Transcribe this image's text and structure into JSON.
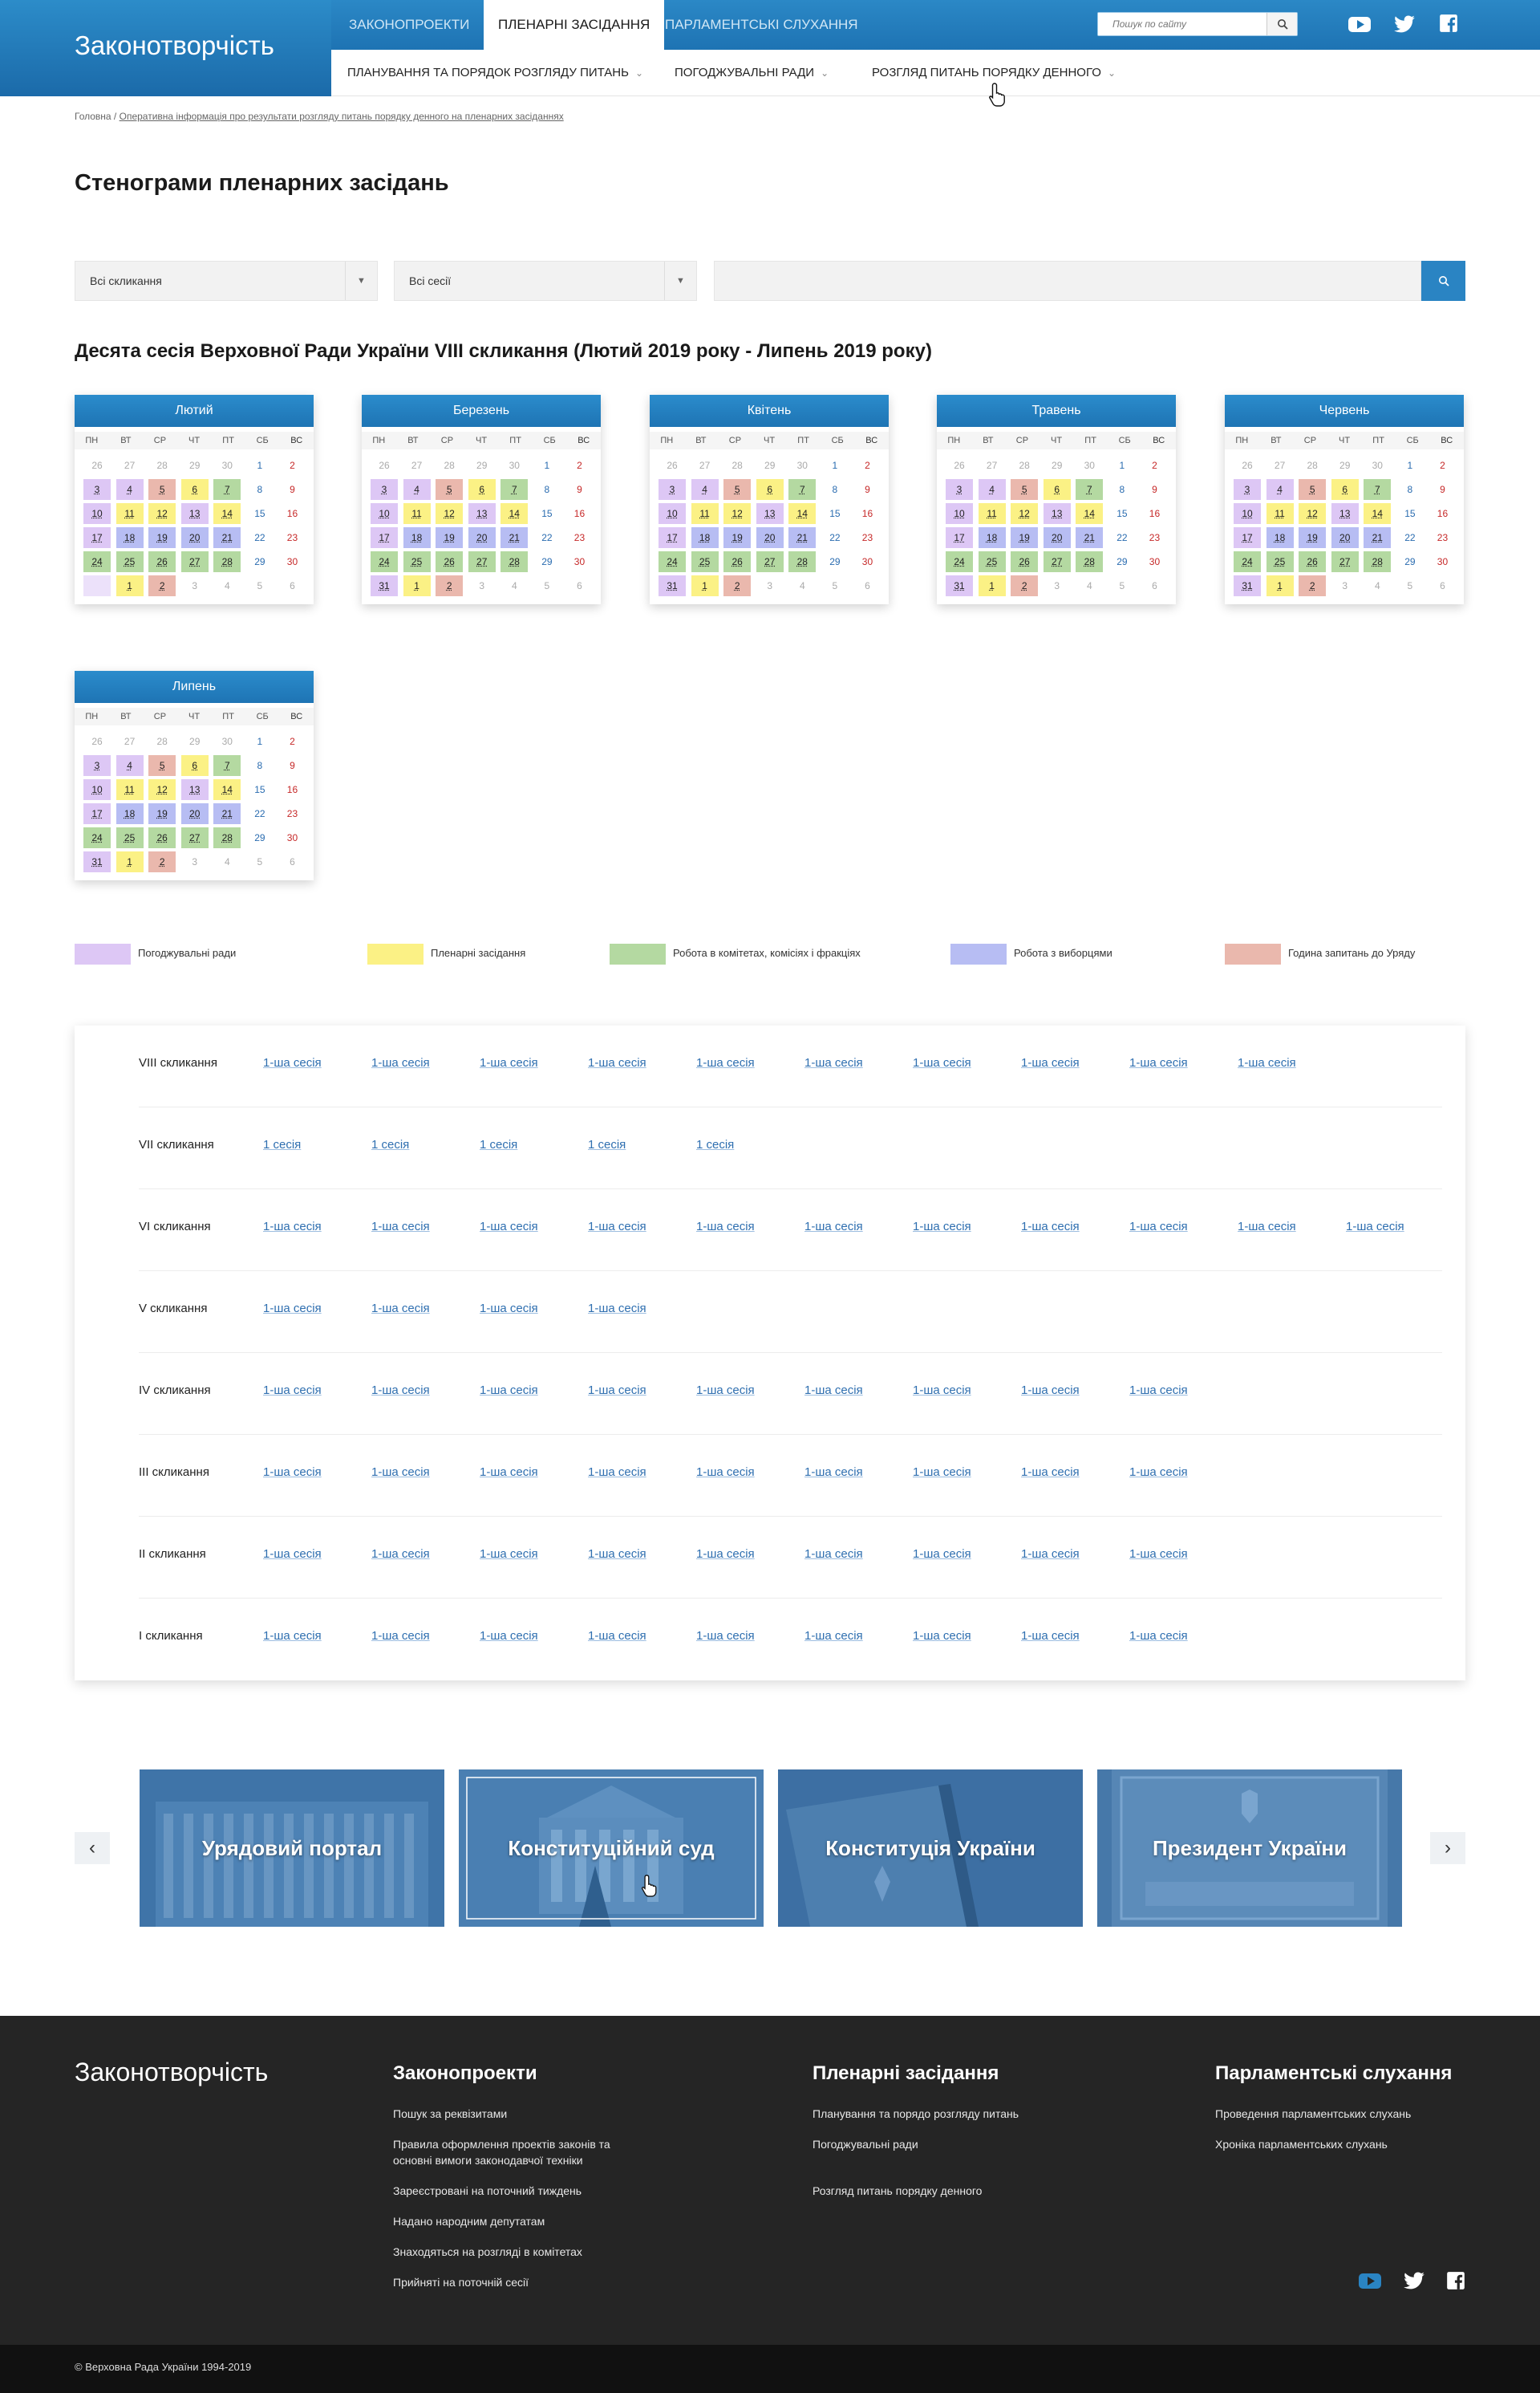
{
  "header": {
    "brand": "Законотворчість",
    "tabs": [
      "Законопроекти",
      "Пленарні засідання",
      "Парламентські слухання"
    ],
    "active_tab": 1,
    "search_placeholder": "Пошук по сайту",
    "social": [
      "youtube-icon",
      "twitter-icon",
      "facebook-icon"
    ]
  },
  "subnav": [
    "Планування та порядок розгляду питань",
    "Погоджувальні ради",
    "Розгляд питань порядку денного"
  ],
  "breadcrumb": {
    "home": "Головна",
    "sep": " / ",
    "current": "Оперативна інформація про результати розгляду питань порядку денного на пленарних засіданнях"
  },
  "page_title": "Стенограми пленарних засідань",
  "filters": {
    "convocation": "Всі скликання",
    "session": "Всі сесії",
    "text": ""
  },
  "session_title": "Десята сесія Верховної Ради України VIII скликання (Лютий 2019 року - Липень 2019 року)",
  "weekdays": [
    "ПН",
    "ВТ",
    "СР",
    "ЧТ",
    "ПТ",
    "СБ",
    "ВС"
  ],
  "months": [
    {
      "name": "Лютий"
    },
    {
      "name": "Березень"
    },
    {
      "name": "Квітень"
    },
    {
      "name": "Травень"
    },
    {
      "name": "Червень"
    },
    {
      "name": "Липень"
    }
  ],
  "calendar_weeks": [
    [
      "26",
      "27",
      "28",
      "29",
      "30",
      "1",
      "2"
    ],
    [
      "3",
      "4",
      "5",
      "6",
      "7",
      "8",
      "9"
    ],
    [
      "10",
      "11",
      "12",
      "13",
      "14",
      "15",
      "16"
    ],
    [
      "17",
      "18",
      "19",
      "20",
      "21",
      "22",
      "23"
    ],
    [
      "24",
      "25",
      "26",
      "27",
      "28",
      "29",
      "30"
    ],
    [
      "31",
      "1",
      "2",
      "3",
      "4",
      "5",
      "6"
    ]
  ],
  "legend": [
    {
      "label": "Погоджувальні ради",
      "color": "#ddc7f5"
    },
    {
      "label": "Пленарні засідання",
      "color": "#fbf185"
    },
    {
      "label": "Робота в комітетах, комісіях і фракціях",
      "color": "#b4d9a1"
    },
    {
      "label": "Робота з виборцями",
      "color": "#b7bdf3"
    },
    {
      "label": "Година запитань до Уряду",
      "color": "#eab8ad"
    }
  ],
  "convocations": [
    {
      "label": "VIII скликання",
      "sessions": [
        "1-ша сесія",
        "1-ша сесія",
        "1-ша сесія",
        "1-ша сесія",
        "1-ша сесія",
        "1-ша сесія",
        "1-ша сесія",
        "1-ша сесія",
        "1-ша сесія",
        "1-ша сесія"
      ]
    },
    {
      "label": "VII скликання",
      "sessions": [
        "1 сесія",
        "1 сесія",
        "1 сесія",
        "1 сесія",
        "1 сесія"
      ]
    },
    {
      "label": "VI скликання",
      "sessions": [
        "1-ша сесія",
        "1-ша сесія",
        "1-ша сесія",
        "1-ша сесія",
        "1-ша сесія",
        "1-ша сесія",
        "1-ша сесія",
        "1-ша сесія",
        "1-ша сесія",
        "1-ша сесія",
        "1-ша сесія"
      ]
    },
    {
      "label": "V скликання",
      "sessions": [
        "1-ша сесія",
        "1-ша сесія",
        "1-ша сесія",
        "1-ша сесія"
      ]
    },
    {
      "label": "IV скликання",
      "sessions": [
        "1-ша сесія",
        "1-ша сесія",
        "1-ша сесія",
        "1-ша сесія",
        "1-ша сесія",
        "1-ша сесія",
        "1-ша сесія",
        "1-ша сесія",
        "1-ша сесія"
      ]
    },
    {
      "label": "III скликання",
      "sessions": [
        "1-ша сесія",
        "1-ша сесія",
        "1-ша сесія",
        "1-ша сесія",
        "1-ша сесія",
        "1-ша сесія",
        "1-ша сесія",
        "1-ша сесія",
        "1-ша сесія"
      ]
    },
    {
      "label": "II скликання",
      "sessions": [
        "1-ша сесія",
        "1-ша сесія",
        "1-ша сесія",
        "1-ша сесія",
        "1-ша сесія",
        "1-ша сесія",
        "1-ша сесія",
        "1-ша сесія",
        "1-ша сесія"
      ]
    },
    {
      "label": "I скликання",
      "sessions": [
        "1-ша сесія",
        "1-ша сесія",
        "1-ша сесія",
        "1-ша сесія",
        "1-ша сесія",
        "1-ша сесія",
        "1-ша сесія",
        "1-ша сесія",
        "1-ша сесія"
      ]
    }
  ],
  "carousel": {
    "prev": "‹",
    "next": "›",
    "items": [
      {
        "label": "Урядовий портал"
      },
      {
        "label": "Конституційний суд"
      },
      {
        "label": "Конституція України"
      },
      {
        "label": "Президент України"
      }
    ]
  },
  "footer": {
    "brand": "Законотворчість",
    "columns": [
      {
        "title": "Законопроекти",
        "links": [
          "Пошук за реквізитами",
          "Правила оформлення проектів законів та основні вимоги законодавчої техніки",
          "Зареєстровані на поточний тиждень",
          "Надано народним депутатам",
          "Знаходяться на розгляді в комітетах",
          "Прийняті на поточній сесії"
        ]
      },
      {
        "title": "Пленарні засідання",
        "links": [
          "Планування та порядо розгляду питань",
          "Погоджувальні ради",
          "Розгляд питань порядку денного"
        ]
      },
      {
        "title": "Парламентські слухання",
        "links": [
          "Проведення парламентських слухань",
          "Хроніка парламентських слухань"
        ]
      }
    ],
    "copyright": "© Верховна Рада України 1994-2019"
  }
}
